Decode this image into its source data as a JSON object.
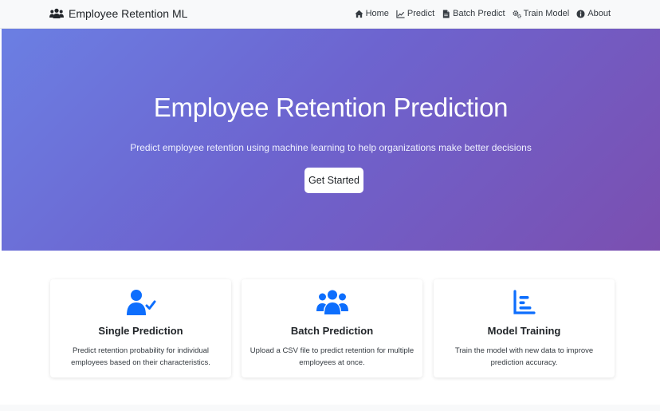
{
  "navbar": {
    "brand_icon": "users-icon",
    "brand": "Employee Retention ML",
    "links": [
      {
        "label": "Home",
        "icon": "home-icon"
      },
      {
        "label": "Predict",
        "icon": "chart-line-icon"
      },
      {
        "label": "Batch Predict",
        "icon": "file-icon"
      },
      {
        "label": "Train Model",
        "icon": "cogs-icon"
      },
      {
        "label": "About",
        "icon": "info-icon"
      }
    ]
  },
  "hero": {
    "title": "Employee Retention Prediction",
    "subtitle": "Predict employee retention using machine learning to help organizations make better decisions",
    "button": "Get Started",
    "gradient": [
      "#6b7fe3",
      "#7b4fb0"
    ]
  },
  "features": [
    {
      "icon": "user-check-icon",
      "title": "Single Prediction",
      "desc": "Predict retention probability for individual employees based on their characteristics."
    },
    {
      "icon": "users-icon",
      "title": "Batch Prediction",
      "desc": "Upload a CSV file to predict retention for multiple employees at once."
    },
    {
      "icon": "chart-bar-icon",
      "title": "Model Training",
      "desc": "Train the model with new data to improve prediction accuracy."
    }
  ],
  "colors": {
    "accent": "#0d6efd",
    "navbar_bg": "#f8f9fa"
  }
}
